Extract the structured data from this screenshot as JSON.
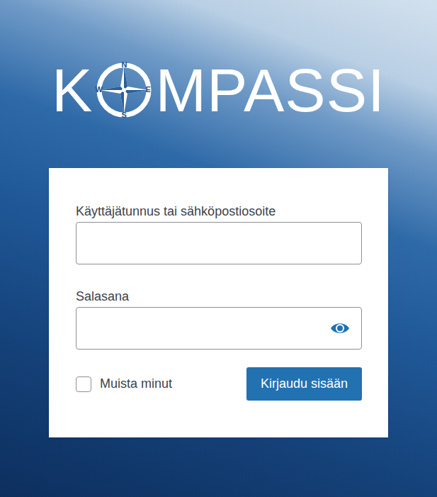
{
  "logo": {
    "before": "K",
    "after": "MPASSI",
    "compass": {
      "n": "N",
      "e": "E",
      "s": "S",
      "w": "W"
    }
  },
  "form": {
    "username": {
      "label": "Käyttäjätunnus tai sähköpostiosoite"
    },
    "password": {
      "label": "Salasana"
    },
    "remember": {
      "label": "Muista minut",
      "checked": false
    },
    "submit": "Kirjaudu sisään"
  }
}
